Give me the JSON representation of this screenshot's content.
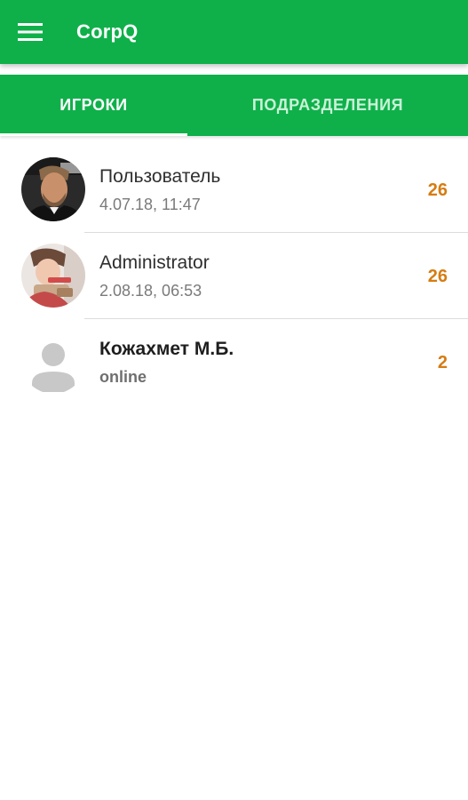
{
  "app": {
    "title": "CorpQ",
    "accent_color": "#0fb04a",
    "score_color": "#d67c12"
  },
  "toolbar": {
    "menu_icon": "hamburger-menu-icon"
  },
  "tabs": [
    {
      "label": "ИГРОКИ",
      "selected": true
    },
    {
      "label": "ПОДРАЗДЕЛЕНИЯ",
      "selected": false
    }
  ],
  "players": [
    {
      "name": "Пользователь",
      "subtitle": "4.07.18, 11:47",
      "score": "26",
      "avatar": "user-photo-avatar"
    },
    {
      "name": "Administrator",
      "subtitle": "2.08.18, 06:53",
      "score": "26",
      "avatar": "user-photo-avatar"
    },
    {
      "name": "Кожахмет М.Б.",
      "subtitle": "online",
      "score": "2",
      "avatar": "default-person-icon"
    }
  ]
}
